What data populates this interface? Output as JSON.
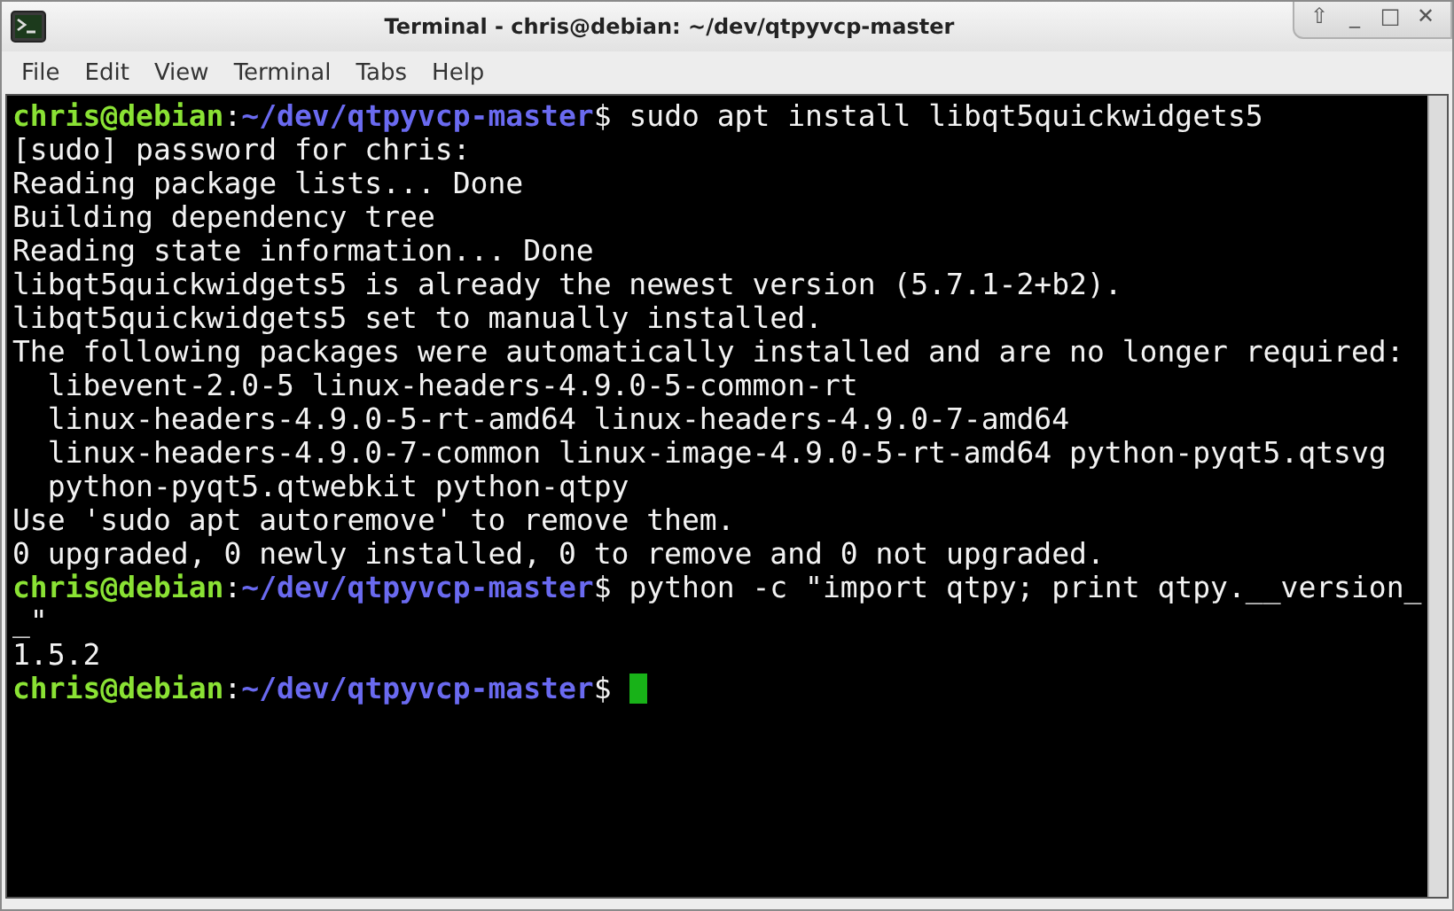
{
  "window": {
    "title": "Terminal - chris@debian: ~/dev/qtpyvcp-master",
    "controls": [
      "⇧",
      "_",
      "□",
      "✕"
    ]
  },
  "menu": [
    {
      "label": "File"
    },
    {
      "label": "Edit"
    },
    {
      "label": "View"
    },
    {
      "label": "Terminal"
    },
    {
      "label": "Tabs"
    },
    {
      "label": "Help"
    }
  ],
  "terminal": {
    "lines": [
      {
        "kind": "prompt",
        "user_host": "chris@debian",
        "separator": ":",
        "path": "~/dev/qtpyvcp-master",
        "symbol": "$",
        "command": "sudo apt install libqt5quickwidgets5"
      },
      {
        "kind": "output",
        "text": "[sudo] password for chris:"
      },
      {
        "kind": "output",
        "text": "Reading package lists... Done"
      },
      {
        "kind": "output",
        "text": "Building dependency tree"
      },
      {
        "kind": "output",
        "text": "Reading state information... Done"
      },
      {
        "kind": "output",
        "text": "libqt5quickwidgets5 is already the newest version (5.7.1-2+b2)."
      },
      {
        "kind": "output",
        "text": "libqt5quickwidgets5 set to manually installed."
      },
      {
        "kind": "output",
        "text": "The following packages were automatically installed and are no longer required:"
      },
      {
        "kind": "output",
        "text": "  libevent-2.0-5 linux-headers-4.9.0-5-common-rt"
      },
      {
        "kind": "output",
        "text": "  linux-headers-4.9.0-5-rt-amd64 linux-headers-4.9.0-7-amd64"
      },
      {
        "kind": "output",
        "text": "  linux-headers-4.9.0-7-common linux-image-4.9.0-5-rt-amd64 python-pyqt5.qtsvg"
      },
      {
        "kind": "output",
        "text": "  python-pyqt5.qtwebkit python-qtpy"
      },
      {
        "kind": "output",
        "text": "Use 'sudo apt autoremove' to remove them."
      },
      {
        "kind": "output",
        "text": "0 upgraded, 0 newly installed, 0 to remove and 0 not upgraded."
      },
      {
        "kind": "prompt",
        "user_host": "chris@debian",
        "separator": ":",
        "path": "~/dev/qtpyvcp-master",
        "symbol": "$",
        "command": "python -c \"import qtpy; print qtpy.__version_"
      },
      {
        "kind": "output",
        "text": "_\""
      },
      {
        "kind": "output",
        "text": "1.5.2"
      },
      {
        "kind": "prompt",
        "user_host": "chris@debian",
        "separator": ":",
        "path": "~/dev/qtpyvcp-master",
        "symbol": "$",
        "cursor": true
      }
    ]
  }
}
